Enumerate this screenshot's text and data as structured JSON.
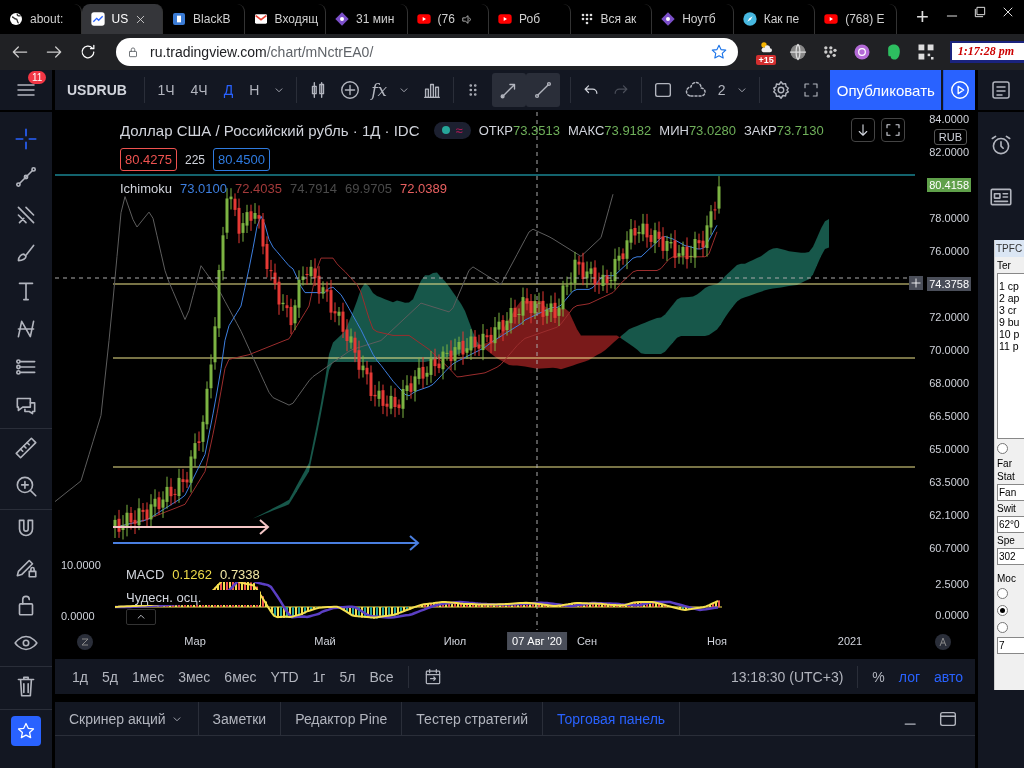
{
  "browser": {
    "tabs": [
      {
        "title": "about:",
        "selected": false,
        "audio": false
      },
      {
        "title": "US",
        "selected": true,
        "audio": false
      },
      {
        "title": "BlackB",
        "selected": false,
        "audio": false
      },
      {
        "title": "Входящ",
        "selected": false,
        "audio": false
      },
      {
        "title": "31 мин",
        "selected": false,
        "audio": false
      },
      {
        "title": "(76",
        "selected": false,
        "audio": true
      },
      {
        "title": "Роб",
        "selected": false,
        "audio": false
      },
      {
        "title": "Вся ак",
        "selected": false,
        "audio": false
      },
      {
        "title": "Ноутб",
        "selected": false,
        "audio": false
      },
      {
        "title": "Как пе",
        "selected": false,
        "audio": false
      },
      {
        "title": "(768) E",
        "selected": false,
        "audio": false
      }
    ],
    "new_tab": "+",
    "url_host": "ru.tradingview.com",
    "url_path": "/chart/mNctrEA0/",
    "weather_badge": "+15",
    "clock": "1:17:28 pm"
  },
  "toolbar": {
    "menu_badge": "11",
    "symbol": "USDRUB",
    "intervals": [
      {
        "label": "1Ч",
        "selected": false
      },
      {
        "label": "4Ч",
        "selected": false
      },
      {
        "label": "Д",
        "selected": true
      },
      {
        "label": "Н",
        "selected": false
      }
    ],
    "indicators_label": "fx",
    "history": [
      {
        "kind": "undo",
        "disabled": false
      },
      {
        "kind": "redo",
        "disabled": true
      }
    ],
    "layout_count": "2",
    "publish": "Опубликовать"
  },
  "drawing_tool_groups": [
    {
      "tools": [
        {
          "kind": "crosshair",
          "selected": true
        },
        {
          "kind": "trend",
          "selected": false
        },
        {
          "kind": "fork",
          "selected": false
        },
        {
          "kind": "brush",
          "selected": false
        },
        {
          "kind": "text",
          "selected": false
        },
        {
          "kind": "pattern",
          "selected": false
        },
        {
          "kind": "forecast",
          "selected": false
        },
        {
          "kind": "comment",
          "selected": false
        }
      ]
    },
    {
      "tools": [
        {
          "kind": "ruler",
          "selected": false
        },
        {
          "kind": "zoom",
          "selected": false
        }
      ]
    },
    {
      "tools": [
        {
          "kind": "magnet",
          "selected": false
        },
        {
          "kind": "pencil-lock",
          "selected": false
        },
        {
          "kind": "lock",
          "selected": false
        },
        {
          "kind": "eye",
          "selected": false
        }
      ]
    },
    {
      "tools": [
        {
          "kind": "trash",
          "selected": false
        }
      ]
    },
    {
      "tools": [
        {
          "kind": "star",
          "selected": true
        }
      ]
    }
  ],
  "chart": {
    "title": "Доллар США / Российский рубль · 1Д · IDC",
    "status_glyph": "≈",
    "ohlc": [
      {
        "label": "ОТКР",
        "value": "73.3513"
      },
      {
        "label": "МАКС",
        "value": "73.9182"
      },
      {
        "label": "МИН",
        "value": "73.0280"
      },
      {
        "label": "ЗАКР",
        "value": "73.7130"
      }
    ],
    "sell_price": "80.4275",
    "spread": "225",
    "buy_price": "80.4500",
    "ichimoku": {
      "name": "Ichimoku",
      "values": [
        {
          "value": "73.0100",
          "color": "#3d7fe0"
        },
        {
          "value": "72.4035",
          "color": "#a33a3a"
        },
        {
          "value": "74.7914",
          "color": "#4a4a4a"
        },
        {
          "value": "69.9705",
          "color": "#4a4a4a"
        },
        {
          "value": "72.0389",
          "color": "#e86060"
        }
      ]
    },
    "currency": "RUB",
    "price_scale": [
      {
        "label": "84.0000",
        "kind": "tick"
      },
      {
        "label": "82.0000",
        "kind": "tick"
      },
      {
        "label": "80.4158",
        "kind": "last"
      },
      {
        "label": "78.0000",
        "kind": "tick"
      },
      {
        "label": "76.0000",
        "kind": "tick"
      },
      {
        "label": "74.3758",
        "kind": "crosshair"
      },
      {
        "label": "72.0000",
        "kind": "tick"
      },
      {
        "label": "70.0000",
        "kind": "tick"
      },
      {
        "label": "68.0000",
        "kind": "tick"
      },
      {
        "label": "66.5000",
        "kind": "tick"
      },
      {
        "label": "65.0000",
        "kind": "tick"
      },
      {
        "label": "63.5000",
        "kind": "tick"
      },
      {
        "label": "62.1000",
        "kind": "tick"
      },
      {
        "label": "60.7000",
        "kind": "tick"
      }
    ],
    "macd": {
      "name": "MACD",
      "values": [
        {
          "value": "0.1262",
          "color": "#f0dc4a"
        },
        {
          "value": "0.7338",
          "color": "#f3e9a6"
        }
      ],
      "second_name": "Чудесн. осц.",
      "left_scale": [
        "10.0000",
        "0.0000"
      ],
      "price_scale": [
        "2.5000",
        "0.0000"
      ]
    },
    "time_axis": [
      {
        "label": "Мар",
        "kind": "tick"
      },
      {
        "label": "Май",
        "kind": "tick"
      },
      {
        "label": "Июл",
        "kind": "tick"
      },
      {
        "label": "07 Авг '20",
        "kind": "crosshair"
      },
      {
        "label": "Сен",
        "kind": "tick"
      },
      {
        "label": "Ноя",
        "kind": "tick"
      },
      {
        "label": "2021",
        "kind": "tick"
      }
    ]
  },
  "bottom_bar": {
    "ranges": [
      "1д",
      "5д",
      "1мес",
      "3мес",
      "6мес",
      "YTD",
      "1г",
      "5л",
      "Все"
    ],
    "time": "13:18:30 (UTC+3)",
    "toggles": [
      {
        "label": "%",
        "on": false
      },
      {
        "label": "лог",
        "on": true
      },
      {
        "label": "авто",
        "on": true
      }
    ]
  },
  "bottom_panel": {
    "tabs": [
      {
        "label": "Скринер акций",
        "selected": false,
        "menu": true
      },
      {
        "label": "Заметки",
        "selected": false,
        "menu": false
      },
      {
        "label": "Редактор Pine",
        "selected": false,
        "menu": false
      },
      {
        "label": "Тестер стратегий",
        "selected": false,
        "menu": false
      },
      {
        "label": "Торговая панель",
        "selected": true,
        "menu": false
      }
    ]
  },
  "tpfc": {
    "title": "TPFC",
    "group_1": "Ter",
    "list": [
      "1 cp",
      "2 ap",
      "3 cr",
      "9 bu",
      "10 p",
      "11 p"
    ],
    "radio_top": {
      "selected": false
    },
    "group_2": "Far",
    "status_label": "Stat",
    "status_value": "Fan",
    "switch_label": "Swit",
    "switch_value": "62°0",
    "speed_label": "Spe",
    "speed_value": "302",
    "mode_label": "Moc",
    "modes": [
      {
        "selected": false
      },
      {
        "selected": true
      },
      {
        "selected": false
      }
    ],
    "mode_value": "7"
  }
}
